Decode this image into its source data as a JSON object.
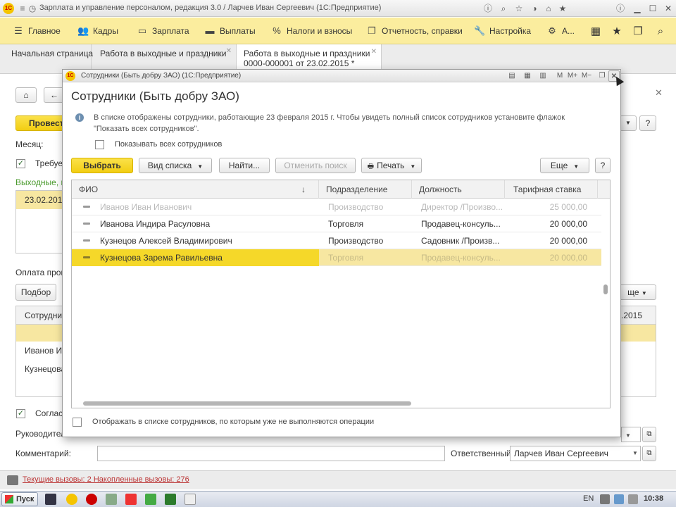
{
  "window": {
    "title": "Зарплата и управление персоналом, редакция 3.0 / Ларчев Иван Сергеевич  (1С:Предприятие)"
  },
  "sections": [
    {
      "label": "Главное",
      "icon": "menu-icon"
    },
    {
      "label": "Кадры",
      "icon": "people-icon"
    },
    {
      "label": "Зарплата",
      "icon": "wallet-icon"
    },
    {
      "label": "Выплаты",
      "icon": "payments-icon"
    },
    {
      "label": "Налоги и взносы",
      "icon": "percent-icon"
    },
    {
      "label": "Отчетность, справки",
      "icon": "reports-icon"
    },
    {
      "label": "Настройка",
      "icon": "wrench-icon"
    },
    {
      "label": "А...",
      "icon": "gear-icon"
    }
  ],
  "tabs": [
    {
      "label": "Начальная страница"
    },
    {
      "label": "Работа в выходные и праздники"
    },
    {
      "label": "Работа в выходные и праздники",
      "label2": "0000-000001 от 23.02.2015 *"
    }
  ],
  "background_form": {
    "post_button": "Провест",
    "month_label": "Месяц:",
    "required_label": "Требуе",
    "weekend_label": "Выходные, п",
    "date_value": "23.02.2015",
    "payment_label": "Оплата прои",
    "select_button": "Подбор",
    "employee_col": "Сотрудни",
    "employees": [
      "Иванов И",
      "Кузнецова"
    ],
    "date_col_right": ".2015",
    "more_right": "ще",
    "agree_label": "Соглас",
    "manager_label": "Руководител",
    "comment_label": "Комментарий:",
    "responsible_label": "Ответственный:",
    "responsible_value": "Ларчев Иван Сергеевич"
  },
  "statusbar": {
    "text": "Текущие вызовы: 2   Накопленные вызовы: 276"
  },
  "taskbar": {
    "start_label": "Пуск",
    "lang": "EN",
    "time": "10:38"
  },
  "dialog": {
    "window_title": "Сотрудники (Быть добру ЗАО)  (1С:Предприятие)",
    "header": "Сотрудники (Быть добру ЗАО)",
    "info": "В списке отображены сотрудники, работающие 23 февраля 2015 г. Чтобы увидеть полный список сотрудников установите флажок \"Показать всех сотрудников\".",
    "show_all_label": "Показывать всех сотрудников",
    "buttons": {
      "select": "Выбрать",
      "view": "Вид списка",
      "find": "Найти...",
      "cancel_search": "Отменить поиск",
      "print": "Печать",
      "more": "Еще",
      "help": "?"
    },
    "columns": [
      "ФИО",
      "Подразделение",
      "Должность",
      "Тарифная ставка"
    ],
    "rows": [
      {
        "name": "Иванов Иван Иванович",
        "dept": "Производство",
        "position": "Директор /Произво...",
        "rate": "25 000,00",
        "state": "inactive"
      },
      {
        "name": "Иванова Индира Расуловна",
        "dept": "Торговля",
        "position": "Продавец-консуль...",
        "rate": "20 000,00",
        "state": "normal"
      },
      {
        "name": "Кузнецов Алексей Владимирович",
        "dept": "Производство",
        "position": "Садовник /Произв...",
        "rate": "20 000,00",
        "state": "normal"
      },
      {
        "name": "Кузнецова Зарема Равильевна",
        "dept": "Торговля",
        "position": "Продавец-консуль...",
        "rate": "20 000,00",
        "state": "selected"
      }
    ],
    "show_inactive_label": "Отображать в списке сотрудников, по которым уже не выполняются операции"
  }
}
